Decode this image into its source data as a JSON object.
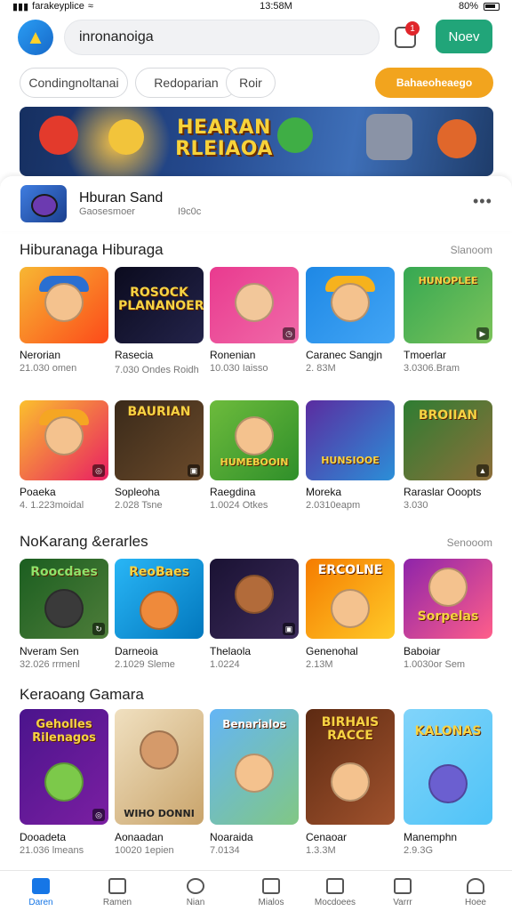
{
  "status": {
    "carrier": "farakeyplice",
    "time": "13:58M",
    "battery": "80%"
  },
  "header": {
    "search_value": "inronanoiga",
    "notif_count": "1",
    "new_button": "Noev"
  },
  "chips": [
    "Condingnoltanai",
    "Redoparian",
    "Roir"
  ],
  "cta": "Bahaeoheaego",
  "banner": {
    "title": "HEARAN RLEIAOA"
  },
  "featured": {
    "name": "Hburan Sand",
    "meta": "Gaosesmoer",
    "meta2": "I9c0c"
  },
  "sections": [
    {
      "title": "Hiburanaga Hiburaga",
      "more": "Slanoom",
      "items": [
        {
          "name": "Nerorian",
          "meta": "21.030 omen",
          "logo": ""
        },
        {
          "name": "Rasecia",
          "meta": "7.030 Ondes Roidh",
          "logo": "ROSOCK PLANANOER"
        },
        {
          "name": "Ronenian",
          "meta": "10.030 Iaisso",
          "logo": ""
        },
        {
          "name": "Caranec Sangjn",
          "meta": "2. 83M",
          "logo": ""
        },
        {
          "name": "Tmoerlar",
          "meta": "3.0306.Bram",
          "logo": "HUNOPLEE"
        }
      ]
    },
    {
      "title": "",
      "more": "",
      "items": [
        {
          "name": "Poaeka",
          "meta": "4. 1.223moidal",
          "logo": ""
        },
        {
          "name": "Sopleoha",
          "meta": "2.028 Tsne",
          "logo": "BAURIAN"
        },
        {
          "name": "Raegdina",
          "meta": "1.0024 Otkes",
          "logo": "HUMEBOOIN"
        },
        {
          "name": "Moreka",
          "meta": "2.0310eapm",
          "logo": "HUNSIOOE"
        },
        {
          "name": "Raraslar Ooopts",
          "meta": "3.030",
          "logo": "BROIIAN"
        }
      ]
    },
    {
      "title": "NoKarang &erarles",
      "more": "Senooom",
      "items": [
        {
          "name": "Nveram Sen",
          "meta": "32.026 rrmenl",
          "logo": "Roocdaes"
        },
        {
          "name": "Darneoia",
          "meta": "2.1029 Sleme",
          "logo": "ReoBaes"
        },
        {
          "name": "Thelaola",
          "meta": "1.0224",
          "logo": ""
        },
        {
          "name": "Genenohal",
          "meta": "2.13M",
          "logo": "ERCOLNE"
        },
        {
          "name": "Baboiar",
          "meta": "1.0030or Sem",
          "logo": "Sorpelas"
        }
      ]
    },
    {
      "title": "Keraoang Gamara",
      "more": "",
      "items": [
        {
          "name": "Dooadeta",
          "meta": "21.036 lmeans",
          "logo": "Geholles Rilenagos"
        },
        {
          "name": "Aonaadan",
          "meta": "10020 1epien",
          "logo": "WIHO DONNI"
        },
        {
          "name": "Noaraida",
          "meta": "7.0134",
          "logo": "Benarialos"
        },
        {
          "name": "Cenaoar",
          "meta": "1.3.3M",
          "logo": "BIRHAIS RACCE"
        },
        {
          "name": "Manemphn",
          "meta": "2.9.3G",
          "logo": "KALONAS"
        }
      ]
    }
  ],
  "nav": [
    "Daren",
    "Ramen",
    "Nian",
    "Mialos",
    "Mocdoees",
    "Varrr",
    "Hoee"
  ]
}
